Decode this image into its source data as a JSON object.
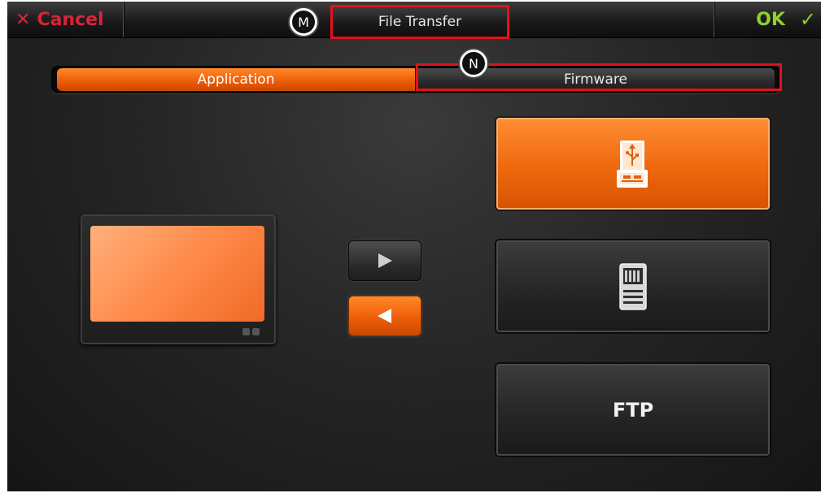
{
  "topbar": {
    "cancel_icon": "✕",
    "cancel_label": "Cancel",
    "title": "File Transfer",
    "ok_label": "OK",
    "ok_icon": "✓"
  },
  "markers": {
    "m": "M",
    "n": "N"
  },
  "tabs": [
    {
      "label": "Application",
      "selected": true
    },
    {
      "label": "Firmware",
      "selected": false
    }
  ],
  "transfer": {
    "right_arrow_icon": "play-right-icon",
    "left_arrow_icon": "play-left-icon",
    "left_arrow_selected": true
  },
  "sources": {
    "usb": {
      "icon": "usb-drive-icon",
      "selected": true
    },
    "sd": {
      "icon": "sd-card-icon",
      "selected": false
    },
    "ftp": {
      "label": "FTP",
      "selected": false
    }
  },
  "colors": {
    "accent_orange": "#f06a10",
    "cancel_red": "#d8243a",
    "ok_green": "#8fcf2e",
    "highlight_red": "#e2111b"
  }
}
